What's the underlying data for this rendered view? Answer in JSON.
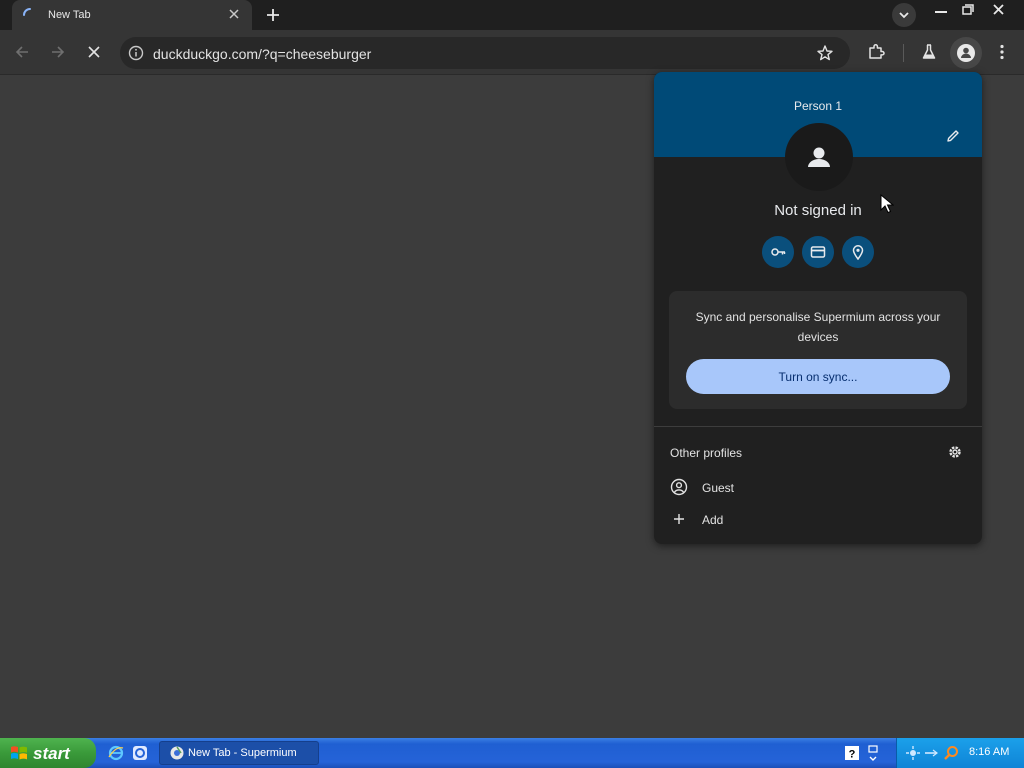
{
  "browser": {
    "tab": {
      "title": "New Tab"
    },
    "omnibox": {
      "url": "duckduckgo.com/?q=cheeseburger"
    }
  },
  "profile_menu": {
    "name": "Person 1",
    "status": "Not signed in",
    "quick_actions": [
      "key-icon",
      "credit-card-icon",
      "location-pin-icon"
    ],
    "sync": {
      "text": "Sync and personalise Supermium across your devices",
      "button_label": "Turn on sync..."
    },
    "other_profiles": {
      "label": "Other profiles",
      "items": [
        {
          "label": "Guest",
          "icon": "guest-icon"
        },
        {
          "label": "Add",
          "icon": "plus-icon"
        }
      ]
    }
  },
  "taskbar": {
    "start_label": "start",
    "task_item": "New Tab - Supermium",
    "clock": "8:16 AM"
  },
  "colors": {
    "banner": "#004a77",
    "sync_button": "#a8c7fa",
    "quick_action_bg": "#0a4f7c",
    "taskbar": "#2563d8",
    "start": "#3a9a3a"
  }
}
